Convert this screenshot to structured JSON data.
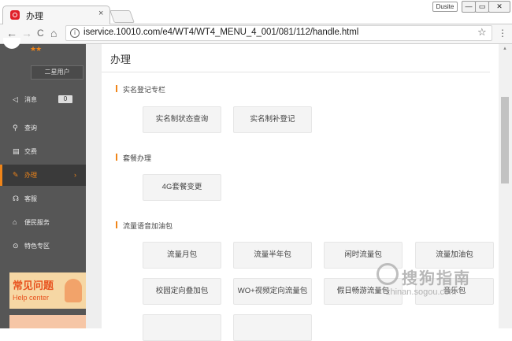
{
  "browser": {
    "tab_title": "办理",
    "tab_close": "×",
    "badge": "Dusite",
    "window_buttons": [
      "—",
      "▭",
      "✕"
    ],
    "url": "iservice.10010.com/e4/WT4/WT4_MENU_4_001/081/112/handle.html",
    "icons": {
      "back": "←",
      "forward": "→",
      "reload": "C",
      "home": "⌂",
      "info": "i",
      "star": "☆",
      "menu": "⋮"
    }
  },
  "sidebar": {
    "stars": "★★",
    "user_button": "二星用户",
    "items": [
      {
        "icon": "◁",
        "label": "消息",
        "badge": "0"
      },
      {
        "icon": "⚲",
        "label": "查询"
      },
      {
        "icon": "▤",
        "label": "交费"
      },
      {
        "icon": "✎",
        "label": "办理",
        "arrow": "›"
      },
      {
        "icon": "☊",
        "label": "客服"
      },
      {
        "icon": "⌂",
        "label": "便民服务"
      },
      {
        "icon": "⊙",
        "label": "特色专区"
      }
    ],
    "banner": {
      "title": "常见问题",
      "subtitle": "Help center"
    }
  },
  "main": {
    "title": "办理",
    "sections": [
      {
        "title": "实名登记专栏",
        "buttons": [
          "实名制状态查询",
          "实名制补登记"
        ]
      },
      {
        "title": "套餐办理",
        "buttons": [
          "4G套餐变更"
        ]
      },
      {
        "title": "流量语音加油包",
        "buttons": [
          "流量月包",
          "流量半年包",
          "闲时流量包",
          "流量加油包",
          "校园定向叠加包",
          "WO+视频定向流量包",
          "假日畅游流量包",
          "音乐包"
        ]
      }
    ]
  },
  "watermark": {
    "text": "搜狗指南",
    "url": "zhinan.sogou.com"
  },
  "colors": {
    "accent": "#f08519",
    "sidebar": "#565656",
    "brand": "#e0202a"
  }
}
